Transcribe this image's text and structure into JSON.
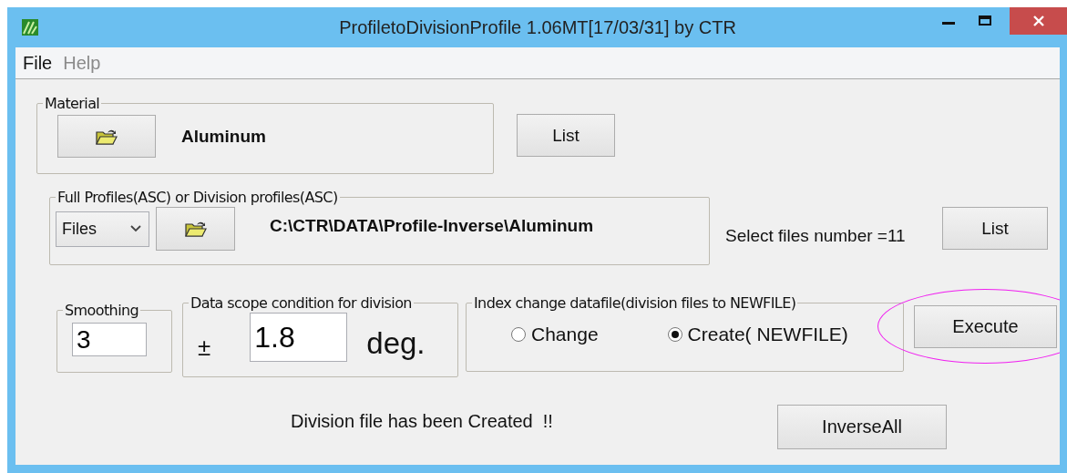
{
  "window": {
    "title": "ProfiletoDivisionProfile 1.06MT[17/03/31] by CTR"
  },
  "menu": [
    {
      "label": "File",
      "disabled": false
    },
    {
      "label": "Help",
      "disabled": true
    }
  ],
  "material": {
    "label": "Material",
    "value": "Aluminum"
  },
  "list_button": "List",
  "profiles": {
    "label": "Full Profiles(ASC) or Division profiles(ASC)",
    "mode": "Files",
    "path": "C:\\CTR\\DATA\\Profile-Inverse\\Aluminum"
  },
  "files_count": "Select files number =11",
  "list_button_2": "List",
  "smoothing": {
    "label": "Smoothing",
    "value": "3"
  },
  "scope": {
    "label": "Data scope condition for division",
    "sign": "±",
    "value": "1.8",
    "unit": "deg."
  },
  "index_change": {
    "label": "Index change datafile(division files to NEWFILE)",
    "options": [
      {
        "label": "Change",
        "selected": false
      },
      {
        "label": "Create( NEWFILE)",
        "selected": true
      }
    ]
  },
  "execute_button": {
    "label": "Execute",
    "highlighted": true
  },
  "status": "Division file has been Created  !!",
  "inverse_button": "InverseAll"
}
